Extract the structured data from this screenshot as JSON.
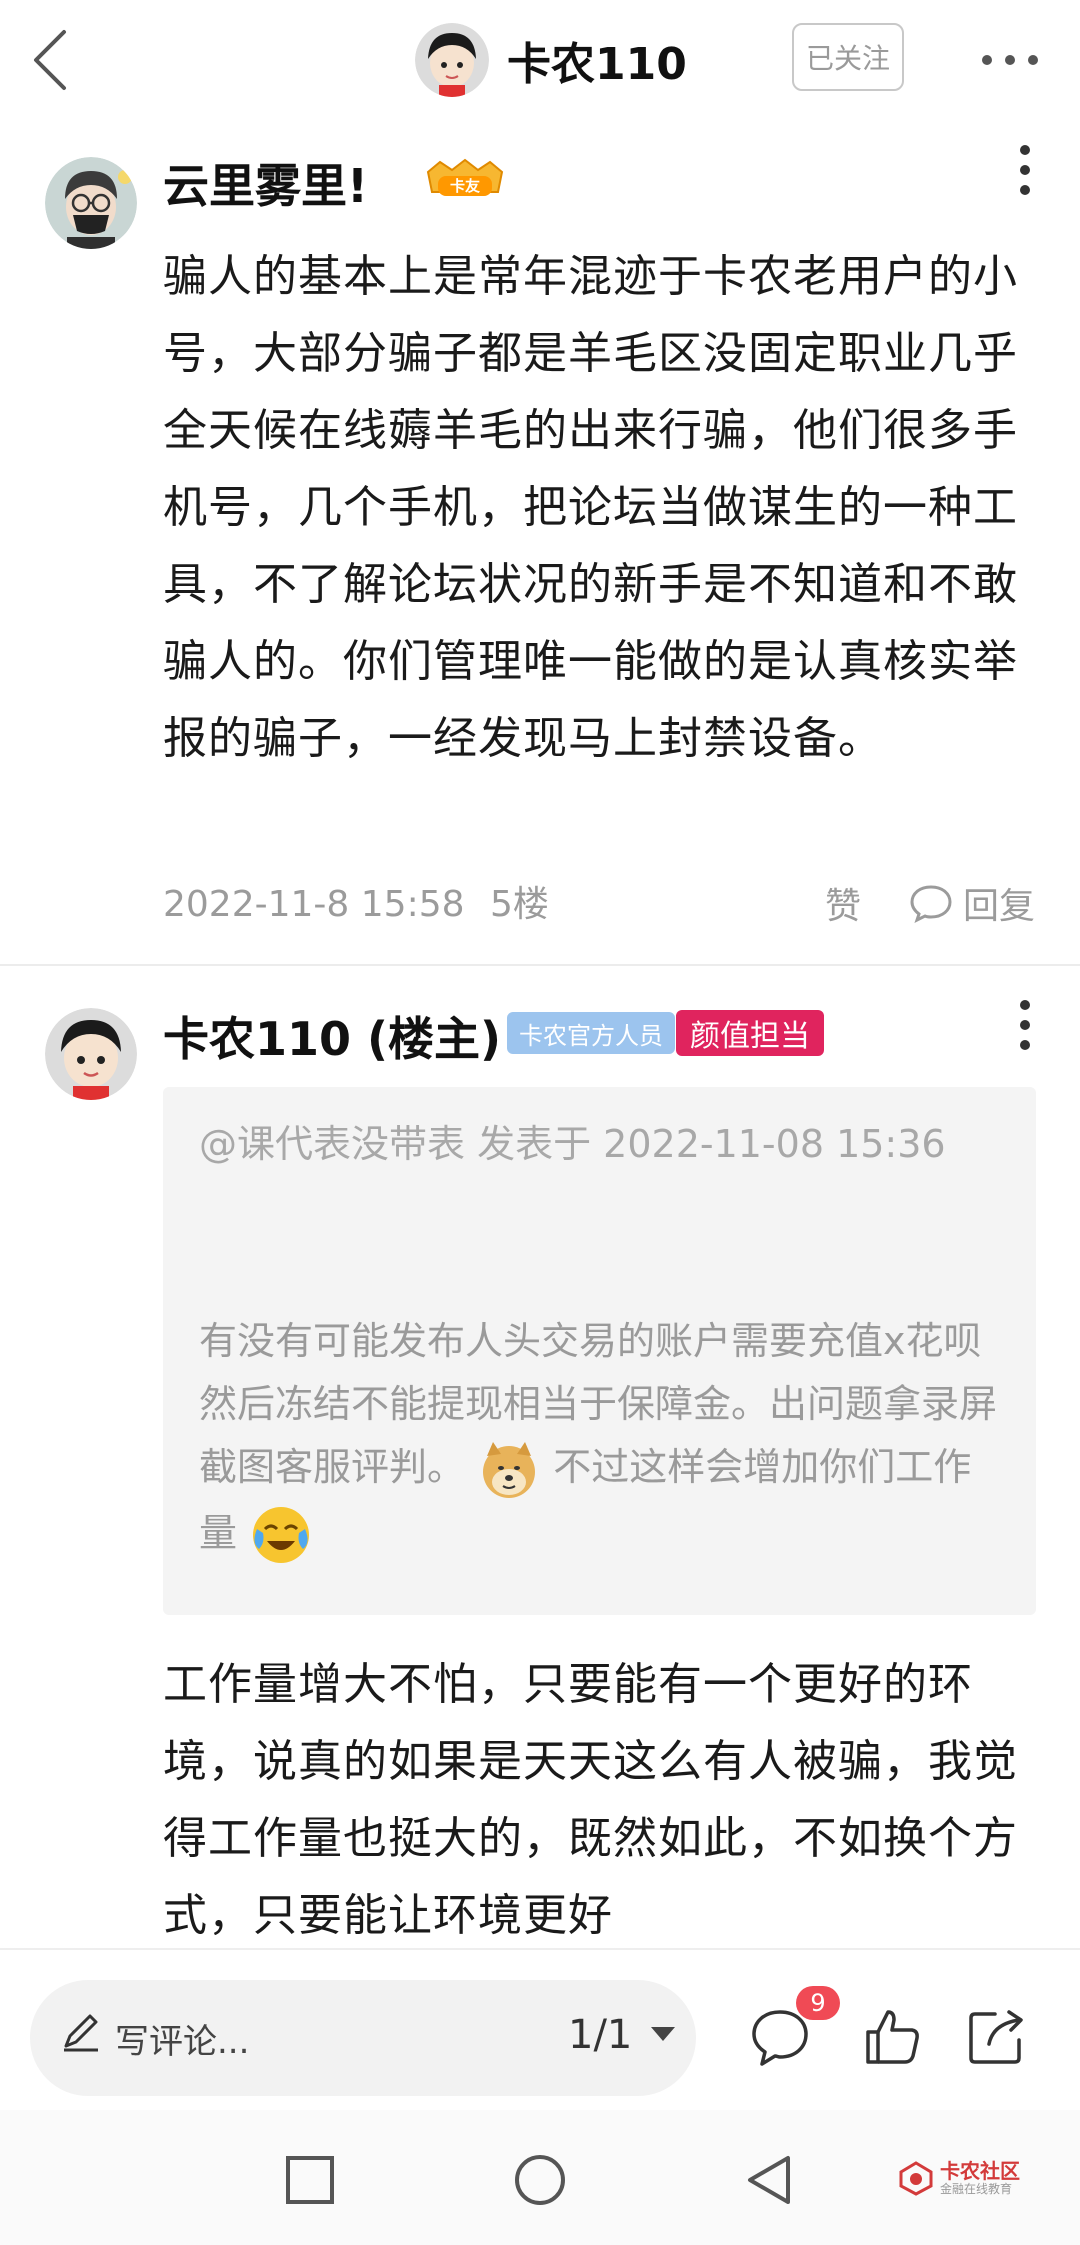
{
  "header": {
    "title": "卡农110",
    "follow_label": "已关注"
  },
  "posts": [
    {
      "username": "云里雾里!",
      "badge": "卡友",
      "text": "骗人的基本上是常年混迹于卡农老用户的小号，大部分骗子都是羊毛区没固定职业几乎全天候在线薅羊毛的出来行骗，他们很多手机号，几个手机，把论坛当做谋生的一种工具，不了解论坛状况的新手是不知道和不敢骗人的。你们管理唯一能做的是认真核实举报的骗子，一经发现马上封禁设备。",
      "timestamp": "2022-11-8 15:58",
      "floor": "5楼",
      "like_label": "赞",
      "reply_label": "回复"
    },
    {
      "username": "卡农110 (楼主)",
      "badge_official": "卡农官方人员",
      "badge_title": "颜值担当",
      "quote_header": "@课代表没带表 发表于 2022-11-08 15:36",
      "quote_text_1": "有没有可能发布人头交易的账户需要充值x花呗然后冻结不能提现相当于保障金。出问题拿录屏截图客服评判。",
      "quote_text_2": "不过这样会增加你们工作量",
      "text": "工作量增大不怕，只要能有一个更好的环境，说真的如果是天天这么有人被骗，我觉得工作量也挺大的，既然如此，不如换个方式，只要能让环境更好"
    }
  ],
  "bottom_bar": {
    "comment_placeholder": "写评论...",
    "page_indicator": "1/1",
    "comment_count": "9"
  },
  "watermark": {
    "title": "卡农社区",
    "subtitle": "金融在线教育"
  },
  "colors": {
    "accent_red": "#e0245e",
    "official_blue": "#9cc4ee",
    "badge_red": "#f04a55"
  }
}
